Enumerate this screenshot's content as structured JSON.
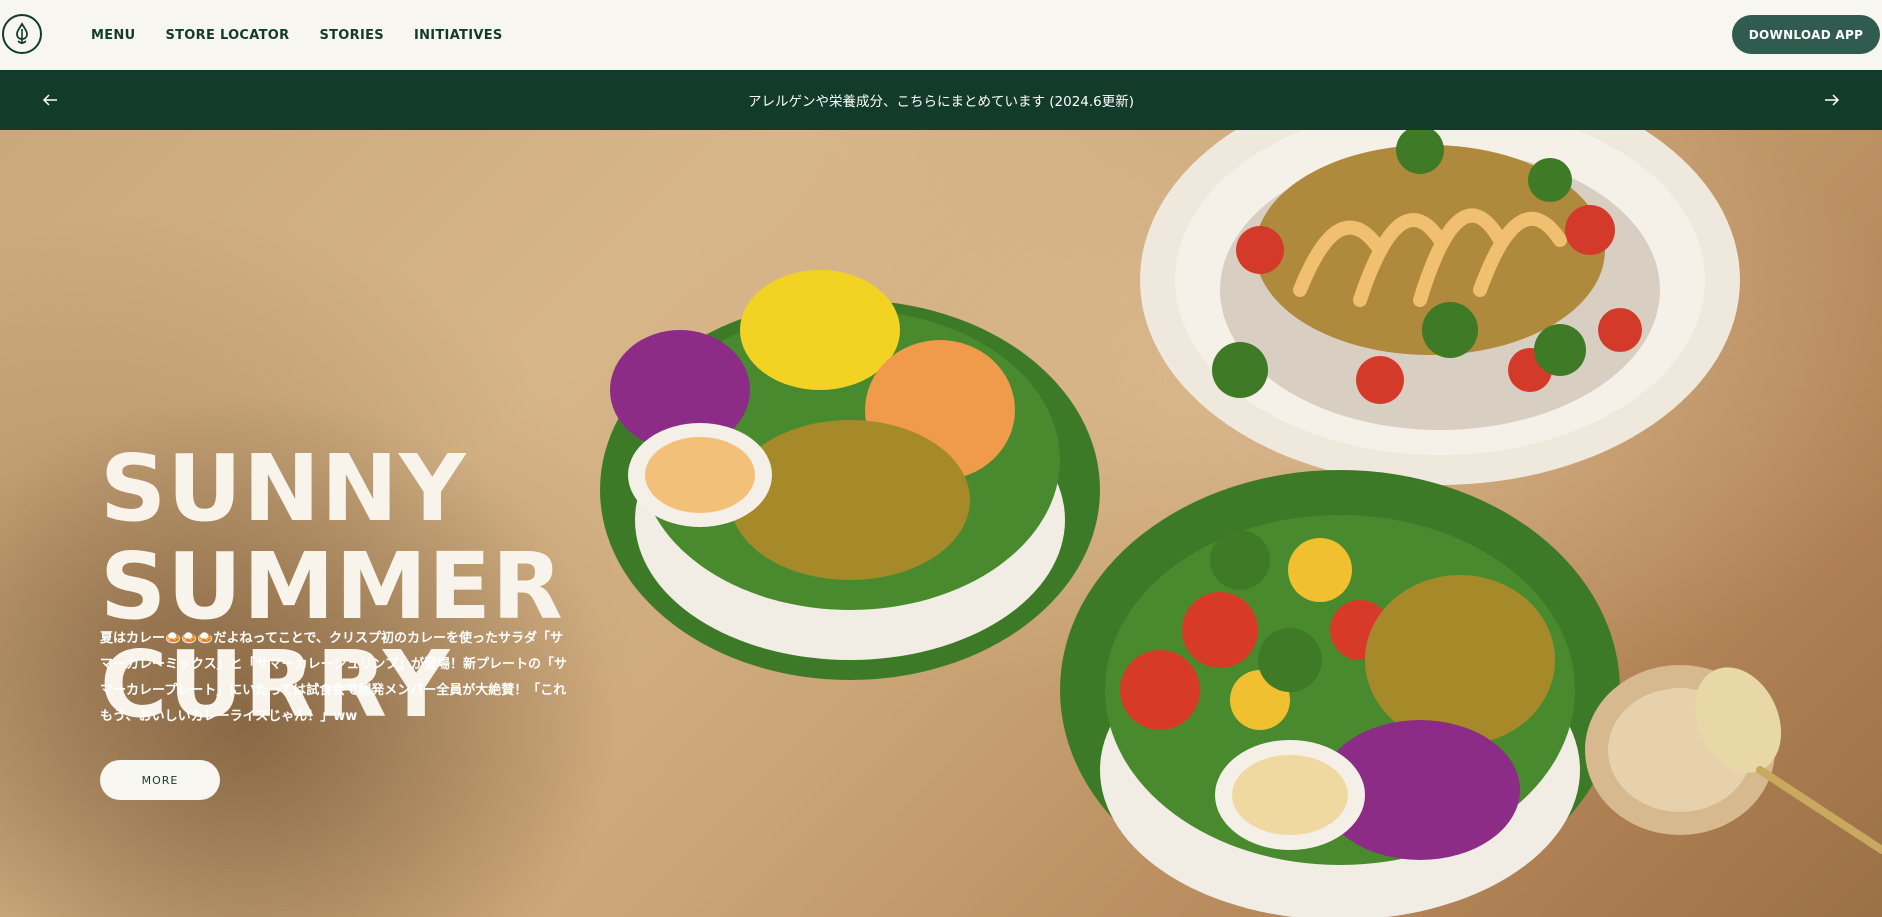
{
  "header": {
    "logo_icon": "leaf-drop-logo-icon",
    "nav": [
      {
        "label": "MENU"
      },
      {
        "label": "STORE LOCATOR"
      },
      {
        "label": "STORIES"
      },
      {
        "label": "INITIATIVES"
      }
    ],
    "download_label": "DOWNLOAD  APP"
  },
  "announcement": {
    "text": "アレルゲンや栄養成分、こちらにまとめています (2024.6更新)",
    "prev_icon": "arrow-left-icon",
    "next_icon": "arrow-right-icon"
  },
  "hero": {
    "title_lines": [
      "SUNNY",
      "SUMMER",
      "CURRY"
    ],
    "description": "夏はカレー🍛🍛🍛だよねってことで、クリスプ初のカレーを使ったサラダ「サマーカレーミックス」と「サマーカレーシュリンプ」が登場！新プレートの「サマーカレープレート」にいたっては試食会で開発メンバー全員が大絶賛！「これもう、おいしいカレーライスじゃん！」ww",
    "more_label": "MORE"
  },
  "colors": {
    "brand_green": "#123b2c",
    "button_green": "#2f5c4e",
    "page_bg": "#f8f6f1"
  }
}
